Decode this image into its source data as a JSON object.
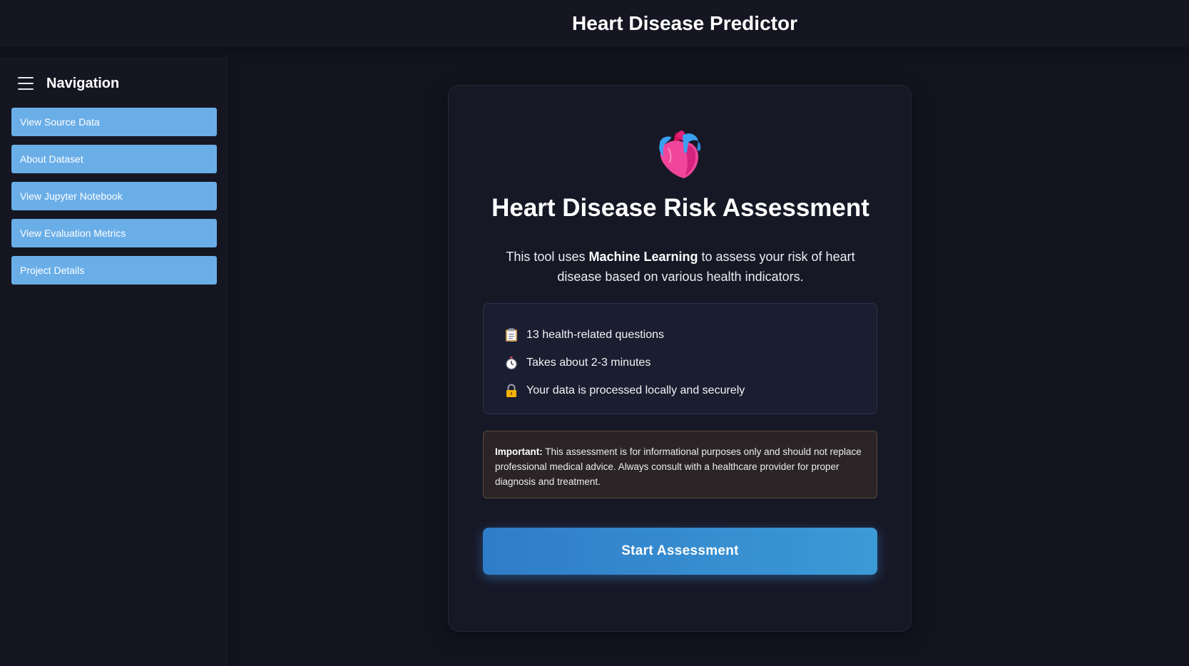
{
  "header": {
    "title": "Heart Disease Predictor"
  },
  "sidebar": {
    "title": "Navigation",
    "items": [
      {
        "label": "View Source Data"
      },
      {
        "label": "About Dataset"
      },
      {
        "label": "View Jupyter Notebook"
      },
      {
        "label": "View Evaluation Metrics"
      },
      {
        "label": "Project Details"
      }
    ]
  },
  "main": {
    "title": "Heart Disease Risk Assessment",
    "intro_prefix": "This tool uses ",
    "intro_bold": "Machine Learning",
    "intro_suffix": " to assess your risk of heart disease based on various health indicators.",
    "info_items": [
      {
        "icon": "clipboard-icon",
        "text": "13 health-related questions"
      },
      {
        "icon": "stopwatch-icon",
        "text": "Takes about 2-3 minutes"
      },
      {
        "icon": "lock-icon",
        "text": "Your data is processed locally and securely"
      }
    ],
    "warning_label": "Important:",
    "warning_text": " This assessment is for informational purposes only and should not replace professional medical advice. Always consult with a healthcare provider for proper diagnosis and treatment.",
    "start_button": "Start Assessment"
  },
  "colors": {
    "background": "#13131f",
    "nav_button": "#6aaee8",
    "accent_start": "#2f7cc8",
    "accent_end": "#3c9ad6",
    "heart": "#f0459a"
  }
}
